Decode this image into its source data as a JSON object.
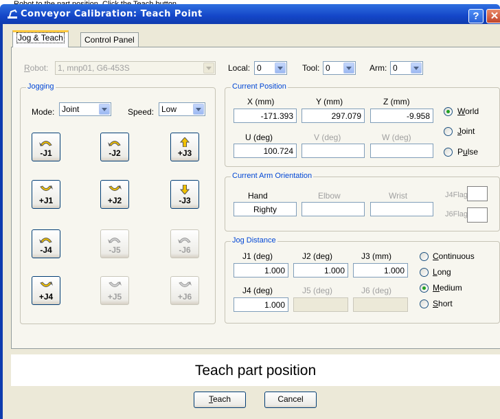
{
  "caption": "Robot to the part position. Click the Teach button.",
  "window": {
    "title": "Conveyor Calibration: Teach Point",
    "help_label": "?",
    "close_label": "✕"
  },
  "tabs": [
    {
      "label": "Jog & Teach"
    },
    {
      "label": "Control Panel"
    }
  ],
  "robot": {
    "label": "Robot:",
    "value": "1, mnp01, G6-453S"
  },
  "local": {
    "label": "Local:",
    "value": "0"
  },
  "tool": {
    "label": "Tool:",
    "value": "0"
  },
  "arm": {
    "label": "Arm:",
    "value": "0"
  },
  "jogging": {
    "title": "Jogging",
    "mode_label": "Mode:",
    "mode_value": "Joint",
    "speed_label": "Speed:",
    "speed_value": "Low",
    "buttons": [
      {
        "label": "-J1"
      },
      {
        "label": "-J2"
      },
      {
        "label": "+J3"
      },
      {
        "label": "+J1"
      },
      {
        "label": "+J2"
      },
      {
        "label": "-J3"
      },
      {
        "label": "-J4"
      },
      {
        "label": "-J5"
      },
      {
        "label": "-J6"
      },
      {
        "label": "+J4"
      },
      {
        "label": "+J5"
      },
      {
        "label": "+J6"
      }
    ]
  },
  "current_position": {
    "title": "Current Position",
    "x_label": "X (mm)",
    "x_value": "-171.393",
    "y_label": "Y (mm)",
    "y_value": "297.079",
    "z_label": "Z (mm)",
    "z_value": "-9.958",
    "u_label": "U (deg)",
    "u_value": "100.724",
    "v_label": "V (deg)",
    "v_value": "",
    "w_label": "W (deg)",
    "w_value": "",
    "world_label": "World",
    "joint_label": "Joint",
    "pulse_label": "Pulse",
    "selected": "World"
  },
  "orientation": {
    "title": "Current Arm Orientation",
    "hand_label": "Hand",
    "hand_value": "Righty",
    "elbow_label": "Elbow",
    "elbow_value": "",
    "wrist_label": "Wrist",
    "wrist_value": "",
    "j4flag_label": "J4Flag",
    "j6flag_label": "J6Flag"
  },
  "jog_distance": {
    "title": "Jog Distance",
    "j1_label": "J1 (deg)",
    "j1_value": "1.000",
    "j2_label": "J2 (deg)",
    "j2_value": "1.000",
    "j3_label": "J3 (mm)",
    "j3_value": "1.000",
    "j4_label": "J4 (deg)",
    "j4_value": "1.000",
    "j5_label": "J5 (deg)",
    "j5_value": "",
    "j6_label": "J6 (deg)",
    "j6_value": "",
    "continuous_label": "Continuous",
    "long_label": "Long",
    "medium_label": "Medium",
    "short_label": "Short",
    "selected": "Medium"
  },
  "status_text": "Teach part position",
  "teach_label": "Teach",
  "cancel_label": "Cancel",
  "colors": {
    "title_bar": "#1446c8",
    "group_title": "#0046d5",
    "jog_arrow": "#f2c200",
    "radio_on": "#21a121"
  }
}
